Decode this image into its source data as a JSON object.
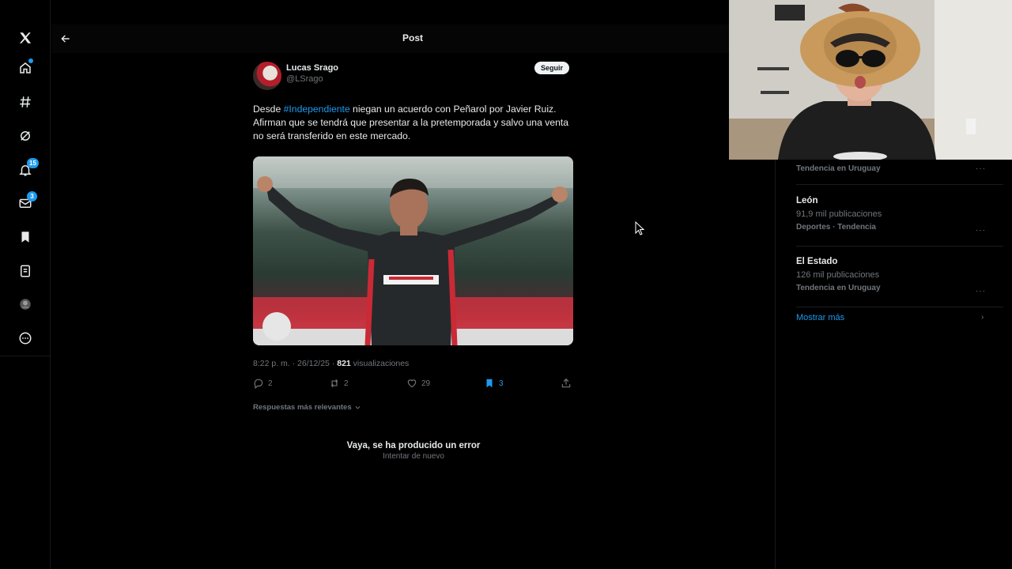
{
  "header": {
    "title": "Post"
  },
  "nav": {
    "notifications_badge": "15",
    "messages_badge": "3"
  },
  "post": {
    "author_name": "Lucas Srago",
    "author_handle": "@LSrago",
    "follow_label": "Seguir",
    "text_before": "Desde ",
    "hashtag": "#Independiente",
    "text_after": " niegan un acuerdo con Peñarol por Javier Ruiz. Afirman que se tendrá que presentar a la pretemporada y salvo una venta no será transferido en este mercado.",
    "meta_time": "8:22 p. m. · 26/12/25 · ",
    "meta_views": "821",
    "meta_views_label": " visualizaciones",
    "replies": "2",
    "reposts": "2",
    "likes": "29",
    "bookmarks": "3",
    "sort_label": "Respuestas más relevantes",
    "error_title": "Vaya, se ha producido un error",
    "error_retry": "Intentar de nuevo"
  },
  "sidebar": {
    "trends": [
      {
        "meta_top": "Tendencia en Uruguay"
      },
      {
        "name": "León",
        "count": "91,9 mil publicaciones",
        "meta": "Deportes · Tendencia"
      },
      {
        "name": "El Estado",
        "count": "126 mil publicaciones",
        "meta": "Tendencia en Uruguay"
      }
    ],
    "more_glyph": "···",
    "show_more": "Mostrar más"
  },
  "colors": {
    "accent": "#1d9bf0",
    "background": "#000000",
    "text": "#e7e9ea",
    "muted": "#71767b"
  }
}
